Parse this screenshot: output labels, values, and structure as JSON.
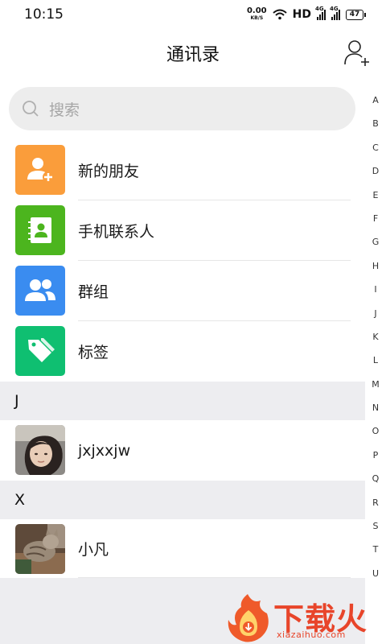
{
  "status_bar": {
    "time": "10:15",
    "net_speed": "0.00",
    "net_unit": "KB/S",
    "hd": "HD",
    "signal1_label": "4G",
    "signal2_label": "4G",
    "battery": "47"
  },
  "header": {
    "title": "通讯录"
  },
  "search": {
    "placeholder": "搜索"
  },
  "functions": [
    {
      "label": "新的朋友",
      "icon": "new-friend-icon",
      "color": "#fa9d3b"
    },
    {
      "label": "手机联系人",
      "icon": "phone-contacts-icon",
      "color": "#4cb51e"
    },
    {
      "label": "群组",
      "icon": "group-icon",
      "color": "#3a8cf0"
    },
    {
      "label": "标签",
      "icon": "tag-icon",
      "color": "#0fbf71"
    }
  ],
  "sections": [
    {
      "letter": "J",
      "contacts": [
        {
          "name": "jxjxxjw"
        }
      ]
    },
    {
      "letter": "X",
      "contacts": [
        {
          "name": "小凡"
        }
      ]
    }
  ],
  "index_letters": [
    "A",
    "B",
    "C",
    "D",
    "E",
    "F",
    "G",
    "H",
    "I",
    "J",
    "K",
    "L",
    "M",
    "N",
    "O",
    "P",
    "Q",
    "R",
    "S",
    "T",
    "U"
  ],
  "watermark": {
    "brand": "下载火",
    "url": "xiazaihuo.com"
  }
}
